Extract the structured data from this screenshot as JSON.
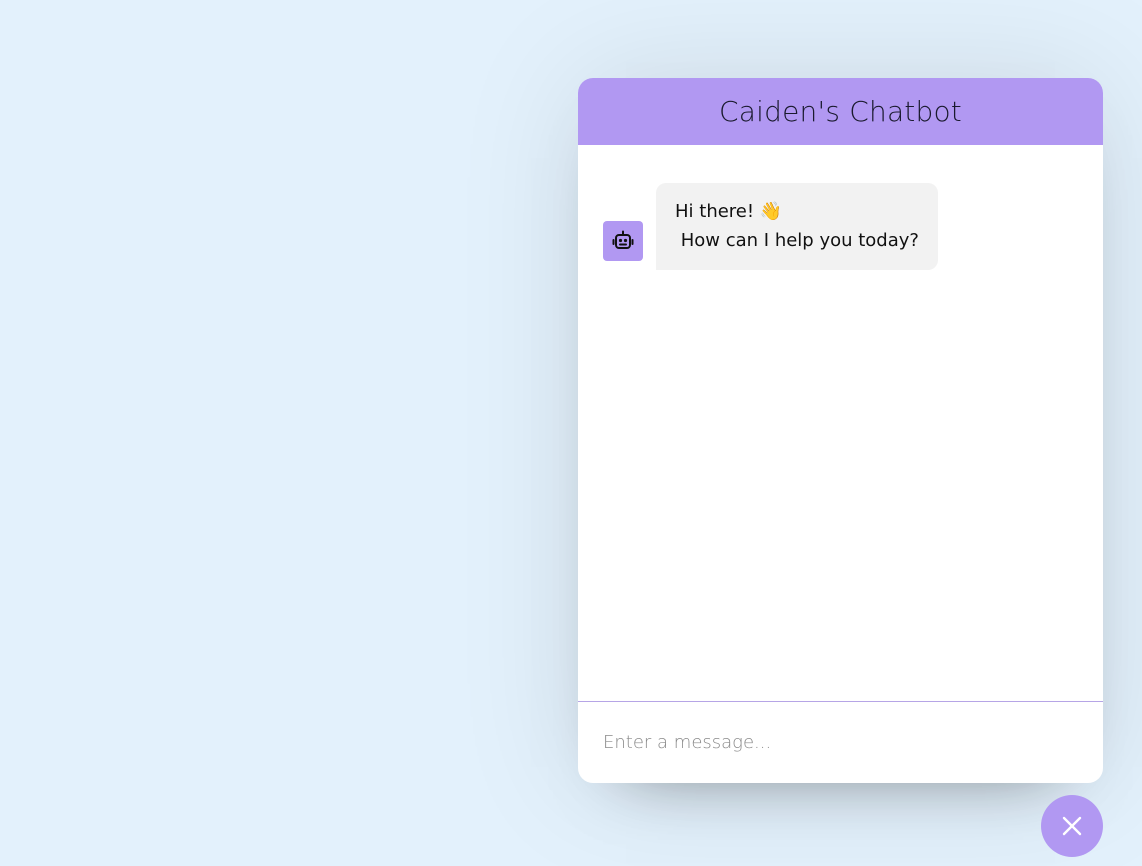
{
  "chatbot": {
    "title": "Caiden's Chatbot",
    "messages": [
      {
        "sender": "bot",
        "avatar_icon": "robot-icon",
        "text": "Hi there! 👋\n How can I help you today?"
      }
    ],
    "input": {
      "placeholder": "Enter a message...",
      "value": ""
    }
  },
  "toggler": {
    "icon": "close-icon"
  },
  "colors": {
    "page_background": "#e3f1fc",
    "accent": "#b198f2",
    "bubble_background": "#f2f2f2",
    "divider": "#b6a5e6"
  }
}
